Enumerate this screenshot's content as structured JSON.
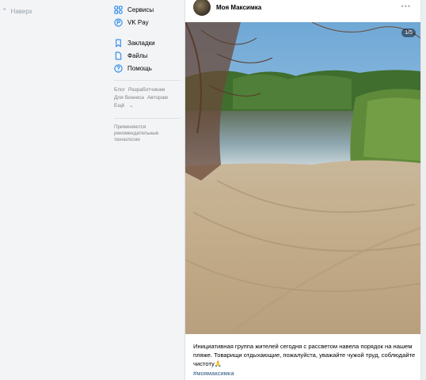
{
  "left": {
    "back_label": "Наверх"
  },
  "nav": {
    "items": [
      {
        "label": "Сервисы",
        "icon": "services-icon"
      },
      {
        "label": "VK Pay",
        "icon": "vk-pay-icon"
      },
      {
        "label": "Закладки",
        "icon": "bookmark-icon"
      },
      {
        "label": "Файлы",
        "icon": "file-icon"
      },
      {
        "label": "Помощь",
        "icon": "help-icon"
      }
    ],
    "footer_links": [
      "Блог",
      "Разработчикам",
      "Для бизнеса",
      "Авторам",
      "Ещё"
    ],
    "note": "Применяются рекомендательные технологии"
  },
  "post": {
    "author": "Моя Максимка",
    "photo_counter": "1/5",
    "text": "Инициативная группа жителей сегодня с рассветом навела порядок на нашем пляже. Товарищи отдыхающие, пожалуйста, уважайте чужой труд, соблюдайте чистоту🙏",
    "hashtag": "#моямаксимка"
  },
  "colors": {
    "accent": "#2688eb",
    "link": "#2a5885",
    "muted": "#828282",
    "background": "#edeef0"
  }
}
